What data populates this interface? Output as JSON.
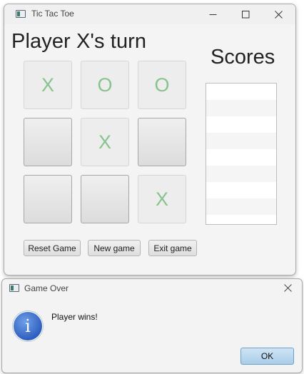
{
  "window": {
    "title": "Tic Tac Toe"
  },
  "game": {
    "turn_label": "Player X's turn",
    "board": [
      "X",
      "O",
      "O",
      "",
      "X",
      "",
      "",
      "",
      "X"
    ]
  },
  "scores": {
    "title": "Scores",
    "rows": 9
  },
  "buttons": {
    "reset": "Reset Game",
    "new_game": "New game",
    "exit": "Exit game"
  },
  "dialog": {
    "title": "Game Over",
    "message": "Player wins!",
    "ok": "OK"
  },
  "colors": {
    "mark": "#8ac28f",
    "ok_button": "#a9cde8"
  },
  "icons": [
    "app-icon",
    "minimize-icon",
    "maximize-icon",
    "close-icon",
    "info-icon"
  ]
}
